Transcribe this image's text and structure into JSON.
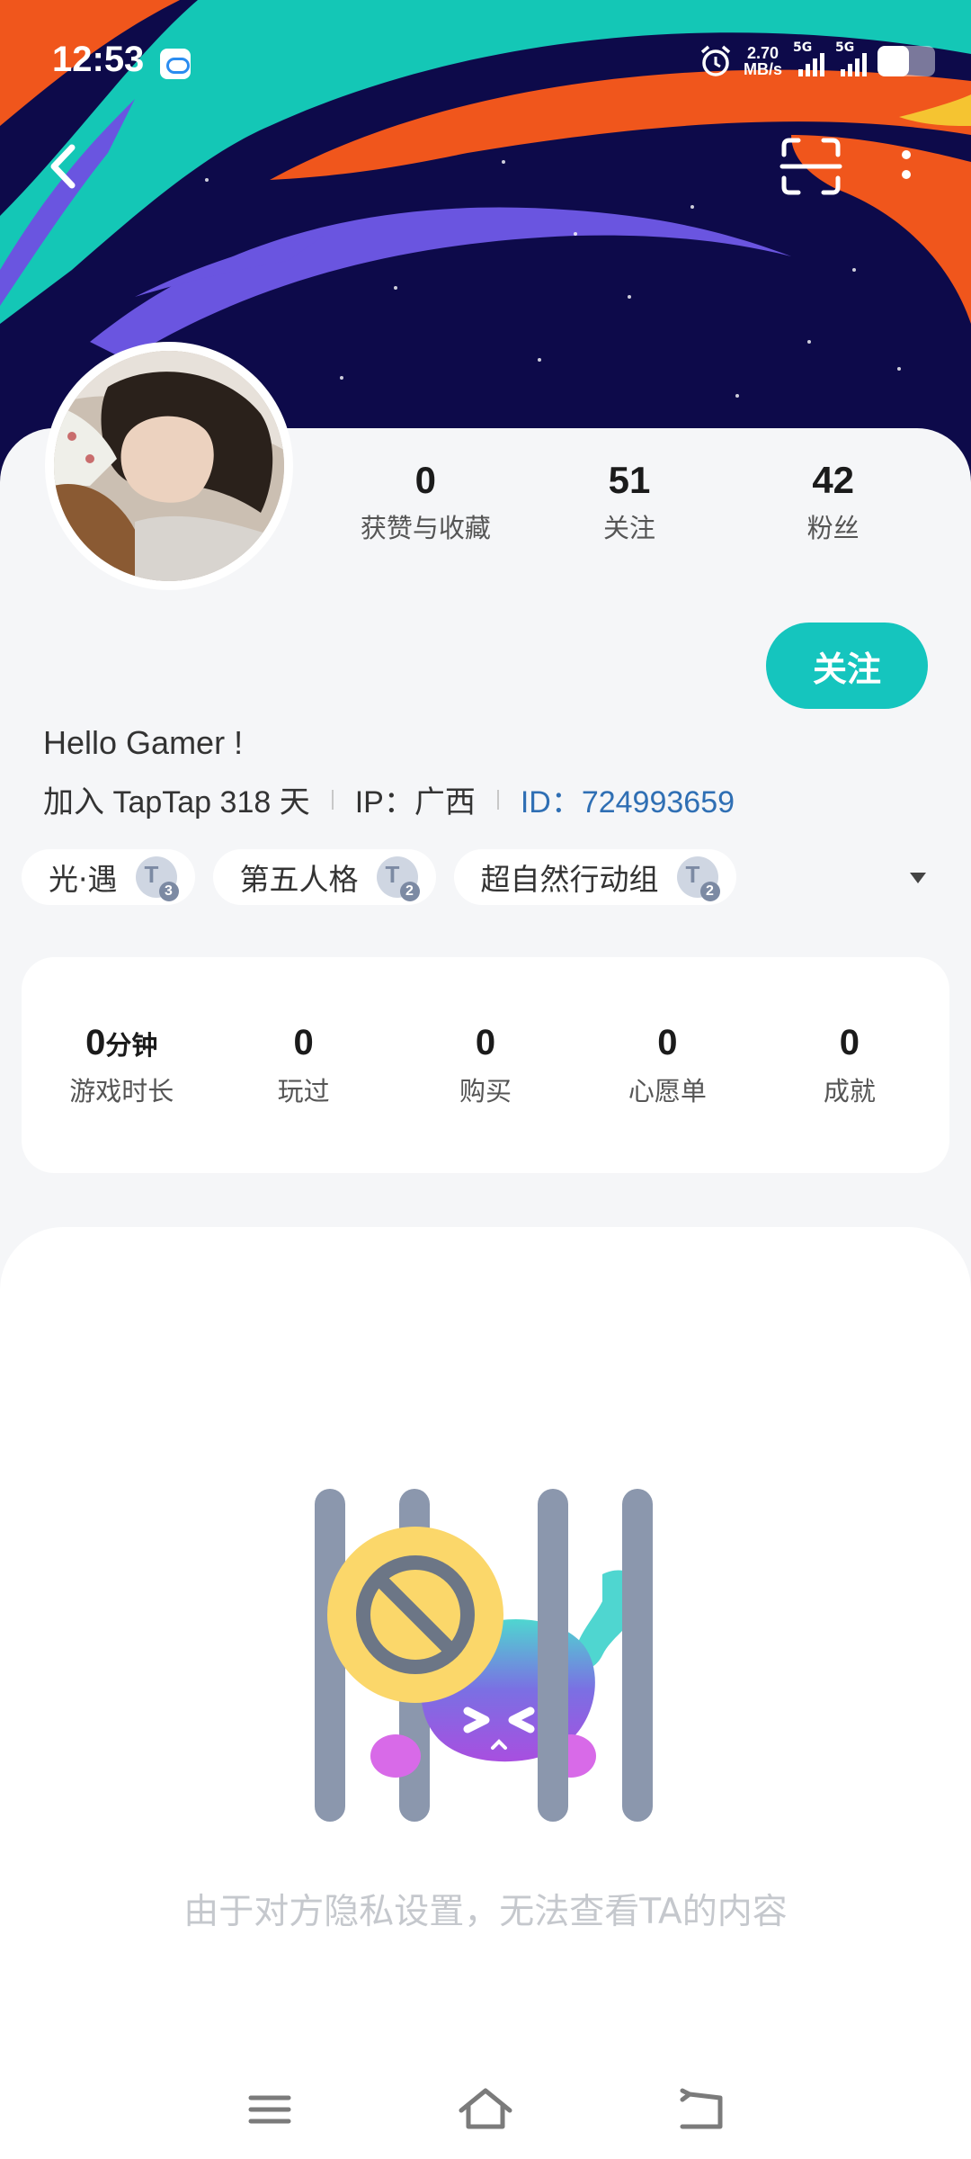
{
  "status_bar": {
    "time": "12:53",
    "net_speed_value": "2.70",
    "net_speed_unit": "MB/s",
    "sim1_label": "5G",
    "sim2_label": "5G",
    "battery_level": 0.55,
    "app_icon": "cloud-app-icon",
    "alarm_icon": "alarm-clock-icon"
  },
  "header": {
    "back_icon": "chevron-left-icon",
    "scan_icon": "scan-icon",
    "more_icon": "more-vertical-icon",
    "banner_colors": [
      "#0d0a4a",
      "#14c7b6",
      "#f0561c",
      "#6a55e0",
      "#f5c431"
    ]
  },
  "profile": {
    "stats": [
      {
        "value": "0",
        "label": "获赞与收藏"
      },
      {
        "value": "51",
        "label": "关注"
      },
      {
        "value": "42",
        "label": "粉丝"
      }
    ],
    "follow_label": "关注",
    "bio": "Hello Gamer !",
    "join_text": "加入 TapTap 318 天",
    "ip_text": "IP：广西",
    "id_text": "ID：724993659",
    "accent_color": "#15c5be",
    "id_color": "#2f6fb4"
  },
  "tags": [
    {
      "name": "光·遇",
      "level_letter": "T",
      "level": "3"
    },
    {
      "name": "第五人格",
      "level_letter": "T",
      "level": "2"
    },
    {
      "name": "超自然行动组",
      "level_letter": "T",
      "level": "2"
    }
  ],
  "game_stats": {
    "playtime_value": "0",
    "playtime_unit": "分钟",
    "playtime_label": "游戏时长",
    "items": [
      {
        "value": "0",
        "label": "玩过"
      },
      {
        "value": "0",
        "label": "购买"
      },
      {
        "value": "0",
        "label": "心愿单"
      },
      {
        "value": "0",
        "label": "成就"
      }
    ]
  },
  "content": {
    "privacy_message": "由于对方隐私设置，无法查看TA的内容"
  },
  "system_nav": {
    "menu_icon": "menu-icon",
    "home_icon": "home-icon",
    "back_icon": "back-arrow-icon"
  }
}
